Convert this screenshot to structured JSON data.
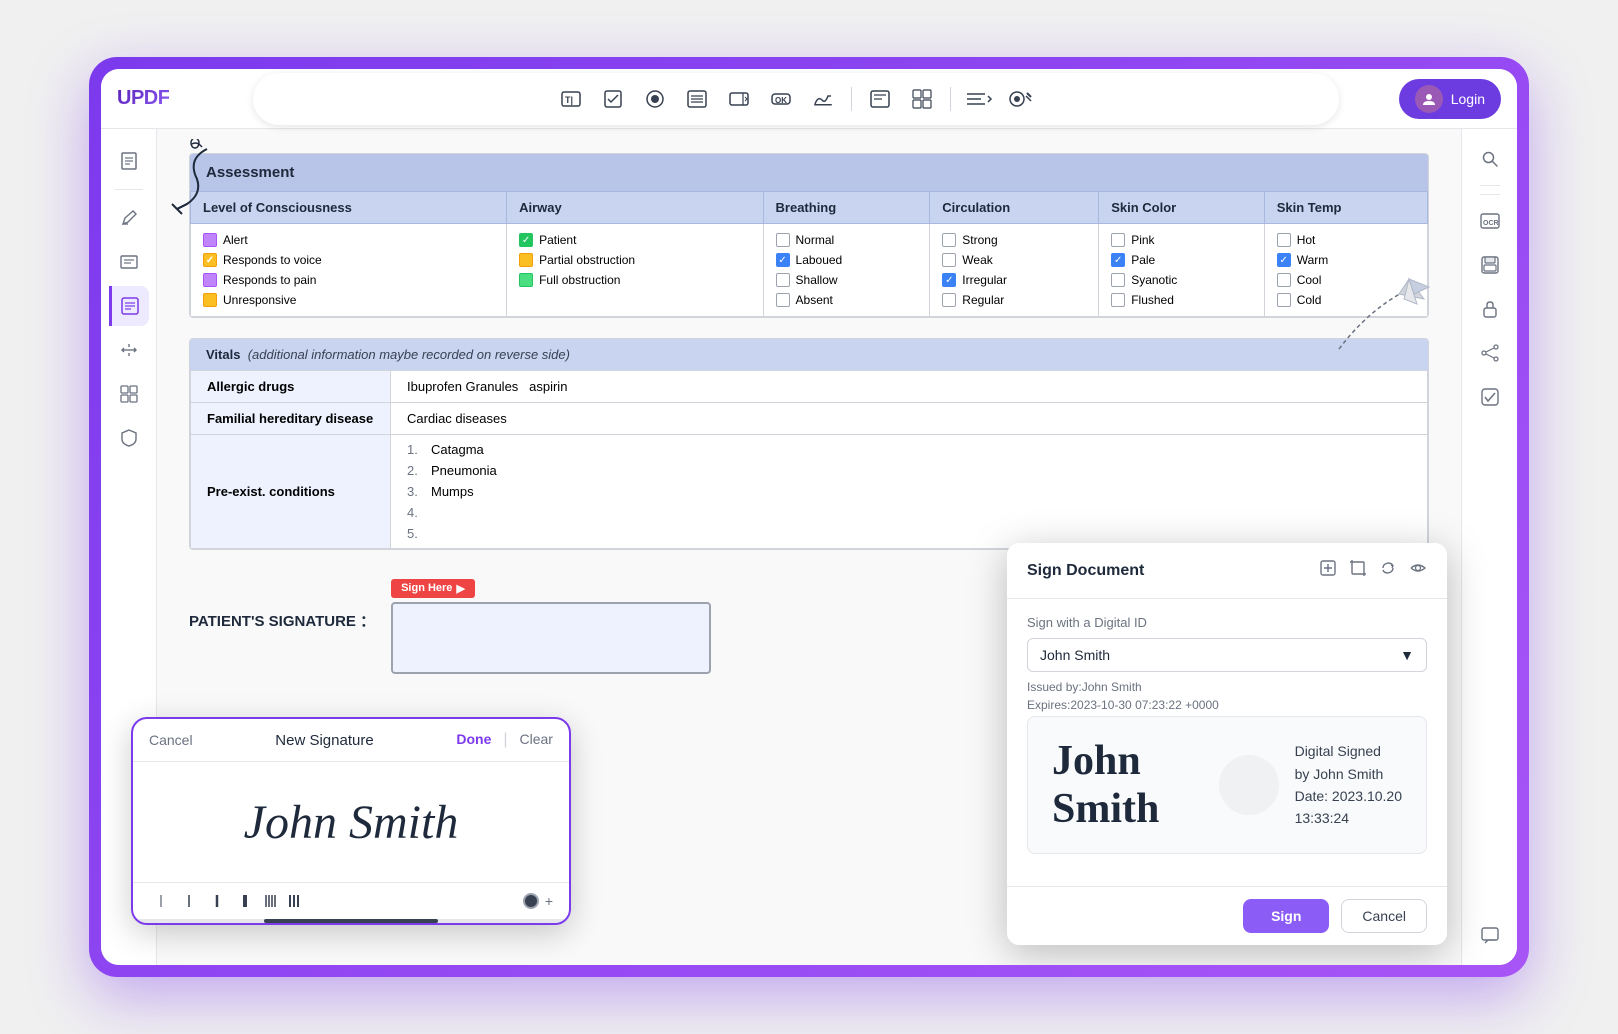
{
  "app": {
    "name": "UPDF",
    "login_label": "Login"
  },
  "toolbar": {
    "buttons": [
      {
        "id": "text-field",
        "icon": "T|",
        "label": "Text Field"
      },
      {
        "id": "checkbox",
        "icon": "☑",
        "label": "Checkbox"
      },
      {
        "id": "radio",
        "icon": "◉",
        "label": "Radio Button"
      },
      {
        "id": "list",
        "icon": "▤",
        "label": "List"
      },
      {
        "id": "combo",
        "icon": "▦",
        "label": "Combo"
      },
      {
        "id": "button",
        "icon": "OK",
        "label": "Button"
      },
      {
        "id": "signature",
        "icon": "✍",
        "label": "Signature"
      },
      {
        "id": "sep1"
      },
      {
        "id": "text2",
        "icon": "▤",
        "label": "Text2"
      },
      {
        "id": "grid",
        "icon": "⊞",
        "label": "Grid"
      },
      {
        "id": "sep2"
      },
      {
        "id": "align",
        "icon": "≡↓",
        "label": "Align"
      },
      {
        "id": "tools",
        "icon": "⚙",
        "label": "Tools"
      }
    ]
  },
  "sidebar": {
    "items": [
      {
        "id": "pages",
        "icon": "▤",
        "label": "Pages"
      },
      {
        "id": "annotate",
        "icon": "✏",
        "label": "Annotate"
      },
      {
        "id": "edit",
        "icon": "≡",
        "label": "Edit"
      },
      {
        "id": "forms",
        "icon": "☐",
        "label": "Forms",
        "active": true
      },
      {
        "id": "convert",
        "icon": "⟲",
        "label": "Convert"
      },
      {
        "id": "organize",
        "icon": "▦",
        "label": "Organize"
      },
      {
        "id": "protect",
        "icon": "🔒",
        "label": "Protect"
      }
    ]
  },
  "assessment": {
    "section_title": "Assessment",
    "columns": [
      "Level of Consciousness",
      "Airway",
      "Breathing",
      "Circulation",
      "Skin Color",
      "Skin Temp"
    ],
    "rows": {
      "consciousness": [
        {
          "label": "Alert",
          "checked": false,
          "color": "purple"
        },
        {
          "label": "Responds to voice",
          "checked": true,
          "color": "yellow"
        },
        {
          "label": "Responds to pain",
          "checked": false,
          "color": "purple"
        },
        {
          "label": "Unresponsive",
          "checked": false,
          "color": "yellow"
        }
      ],
      "airway": [
        {
          "label": "Patient",
          "checked": true,
          "check_color": "green"
        },
        {
          "label": "Partial obstruction",
          "checked": false,
          "check_color": "yellow"
        },
        {
          "label": "Full obstruction",
          "checked": false,
          "check_color": "green"
        }
      ],
      "breathing": [
        {
          "label": "Normal",
          "checked": false
        },
        {
          "label": "Laboued",
          "checked": true
        },
        {
          "label": "Shallow",
          "checked": false
        },
        {
          "label": "Absent",
          "checked": false
        }
      ],
      "circulation": [
        {
          "label": "Strong",
          "checked": false
        },
        {
          "label": "Weak",
          "checked": false
        },
        {
          "label": "Irregular",
          "checked": true
        },
        {
          "label": "Regular",
          "checked": false
        }
      ],
      "skin_color": [
        {
          "label": "Pink",
          "checked": false
        },
        {
          "label": "Pale",
          "checked": true
        },
        {
          "label": "Syanotic",
          "checked": false
        },
        {
          "label": "Flushed",
          "checked": false
        }
      ],
      "skin_temp": [
        {
          "label": "Hot",
          "checked": false
        },
        {
          "label": "Warm",
          "checked": true
        },
        {
          "label": "Cool",
          "checked": false
        },
        {
          "label": "Cold",
          "checked": false
        }
      ]
    }
  },
  "vitals": {
    "section_title": "Vitals",
    "subtitle": "(additional information maybe recorded on reverse side)",
    "rows": [
      {
        "label": "Allergic drugs",
        "value": "Ibuprofen Granules  aspirin"
      },
      {
        "label": "Familial hereditary disease",
        "value": "Cardiac diseases"
      },
      {
        "label": "Pre-exist. conditions",
        "items": [
          {
            "num": "1.",
            "value": "Catagma"
          },
          {
            "num": "2.",
            "value": "Pneumonia"
          },
          {
            "num": "3.",
            "value": "Mumps"
          },
          {
            "num": "4.",
            "value": ""
          },
          {
            "num": "5.",
            "value": ""
          }
        ]
      }
    ]
  },
  "patient_signature": {
    "label": "PATIENT'S SIGNATURE ：",
    "sign_here": "Sign Here"
  },
  "new_signature_panel": {
    "title": "New Signature",
    "cancel": "Cancel",
    "done": "Done",
    "clear": "Clear",
    "signature_text": "John Smith"
  },
  "sign_document_panel": {
    "title": "Sign Document",
    "sign_with_label": "Sign with a Digital ID",
    "signer_name": "John Smith",
    "issued_by": "Issued by:John Smith",
    "expires": "Expires:2023-10-30 07:23:22 +0000",
    "preview_name": "John Smith",
    "preview_digital": "Digital Signed",
    "preview_by": "by John Smith",
    "preview_date": "Date: 2023.10.20",
    "preview_time": "13:33:24",
    "sign_btn": "Sign",
    "cancel_btn": "Cancel"
  }
}
